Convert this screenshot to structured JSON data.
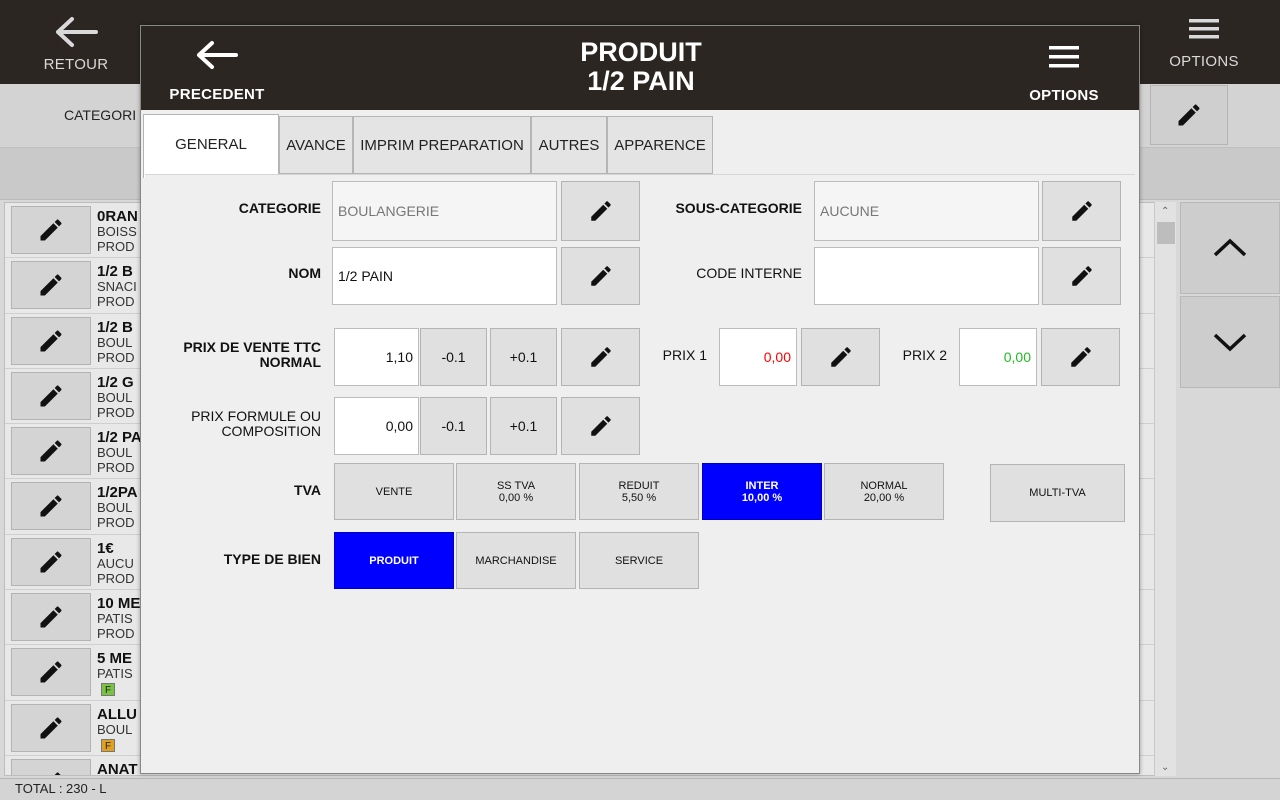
{
  "app": {
    "header": {
      "back_label": "RETOUR",
      "options_label": "OPTIONS"
    },
    "filter": {
      "category_label": "CATEGORI"
    },
    "products": [
      {
        "name": "0RAN",
        "category": "BOISS",
        "type": "PROD"
      },
      {
        "name": "1/2 B",
        "category": "SNACI",
        "type": "PROD"
      },
      {
        "name": "1/2 B",
        "category": "BOUL",
        "type": "PROD"
      },
      {
        "name": "1/2 G",
        "category": "BOUL",
        "type": "PROD"
      },
      {
        "name": "1/2 PA",
        "category": "BOUL",
        "type": "PROD"
      },
      {
        "name": "1/2PA",
        "category": "BOUL",
        "type": "PROD"
      },
      {
        "name": "1€",
        "category": "AUCU",
        "type": "PROD"
      },
      {
        "name": "10 ME",
        "category": "PATIS",
        "type": "PROD"
      },
      {
        "name": "5 ME",
        "category": "PATIS",
        "badge": "F",
        "badge_color": "#7cc242"
      },
      {
        "name": "ALLU",
        "category": "BOUL",
        "badge": "F",
        "badge_color": "#e0a020"
      },
      {
        "name": "ANAT",
        "category": "",
        "type": ""
      }
    ],
    "total_label": "TOTAL : 230  - L"
  },
  "modal": {
    "back_label": "PRECEDENT",
    "title_line1": "PRODUIT",
    "title_line2": "1/2 PAIN",
    "options_label": "OPTIONS",
    "tabs": [
      {
        "label": "GENERAL",
        "active": true
      },
      {
        "label": "AVANCE",
        "active": false
      },
      {
        "label": "IMPRIM PREPARATION",
        "active": false
      },
      {
        "label": "AUTRES",
        "active": false
      },
      {
        "label": "APPARENCE",
        "active": false
      }
    ],
    "general": {
      "category": {
        "label": "CATEGORIE",
        "value": "BOULANGERIE"
      },
      "subcategory": {
        "label": "SOUS-CATEGORIE",
        "value": "AUCUNE"
      },
      "name": {
        "label": "NOM",
        "value": "1/2 PAIN"
      },
      "internal_code": {
        "label": "CODE INTERNE",
        "value": ""
      },
      "sale_price": {
        "label_line1": "PRIX DE VENTE TTC",
        "label_line2": "NORMAL",
        "value": "1,10"
      },
      "price1": {
        "label": "PRIX 1",
        "value": "0,00",
        "color": "#ff0000"
      },
      "price2": {
        "label": "PRIX 2",
        "value": "0,00",
        "color": "#22bb22"
      },
      "formula_price": {
        "label_line1": "PRIX FORMULE OU",
        "label_line2": "COMPOSITION",
        "value": "0,00"
      },
      "decrement_label": "-0.1",
      "increment_label": "+0.1",
      "vat": {
        "label": "TVA",
        "options": [
          {
            "line1": "VENTE",
            "line2": "",
            "selected": false
          },
          {
            "line1": "SS TVA",
            "line2": "0,00 %",
            "selected": false
          },
          {
            "line1": "REDUIT",
            "line2": "5,50 %",
            "selected": false
          },
          {
            "line1": "INTER",
            "line2": "10,00 %",
            "selected": true
          },
          {
            "line1": "NORMAL",
            "line2": "20,00 %",
            "selected": false
          }
        ],
        "multi_label": "MULTI-TVA"
      },
      "goods_type": {
        "label": "TYPE DE BIEN",
        "options": [
          {
            "label": "PRODUIT",
            "selected": true
          },
          {
            "label": "MARCHANDISE",
            "selected": false
          },
          {
            "label": "SERVICE",
            "selected": false
          }
        ]
      }
    },
    "selected_color": "#0000ff"
  }
}
